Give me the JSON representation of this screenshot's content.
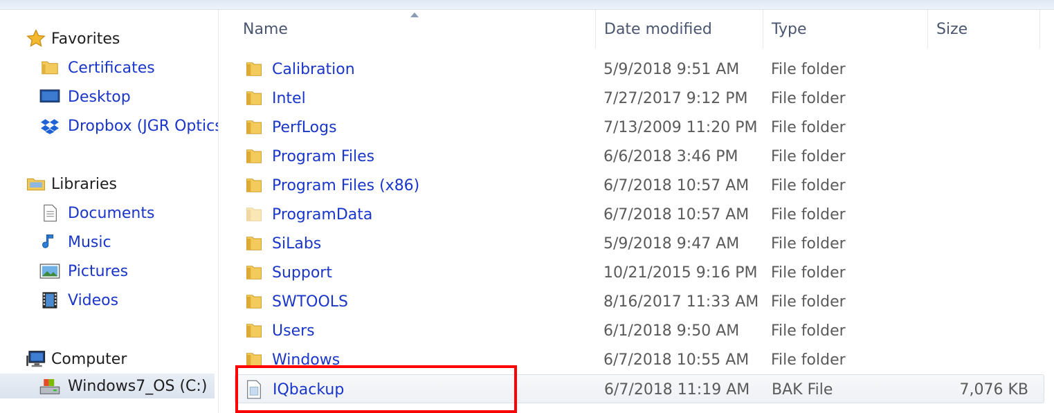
{
  "nav": {
    "favorites": {
      "label": "Favorites",
      "items": [
        {
          "label": "Certificates",
          "icon": "folder-icon"
        },
        {
          "label": "Desktop",
          "icon": "desktop-icon"
        },
        {
          "label": "Dropbox (JGR Optics",
          "icon": "dropbox-icon"
        }
      ]
    },
    "libraries": {
      "label": "Libraries",
      "items": [
        {
          "label": "Documents",
          "icon": "document-icon"
        },
        {
          "label": "Music",
          "icon": "music-note-icon"
        },
        {
          "label": "Pictures",
          "icon": "picture-icon"
        },
        {
          "label": "Videos",
          "icon": "film-icon"
        }
      ]
    },
    "computer": {
      "label": "Computer",
      "items": [
        {
          "label": "Windows7_OS (C:)",
          "icon": "drive-icon",
          "selected": true
        }
      ]
    }
  },
  "columns": {
    "name": "Name",
    "date": "Date modified",
    "type": "Type",
    "size": "Size"
  },
  "files": [
    {
      "name": "Calibration",
      "date": "5/9/2018 9:51 AM",
      "type": "File folder",
      "size": ""
    },
    {
      "name": "Intel",
      "date": "7/27/2017 9:12 PM",
      "type": "File folder",
      "size": ""
    },
    {
      "name": "PerfLogs",
      "date": "7/13/2009 11:20 PM",
      "type": "File folder",
      "size": ""
    },
    {
      "name": "Program Files",
      "date": "6/6/2018 3:46 PM",
      "type": "File folder",
      "size": ""
    },
    {
      "name": "Program Files (x86)",
      "date": "6/7/2018 10:57 AM",
      "type": "File folder",
      "size": ""
    },
    {
      "name": "ProgramData",
      "date": "6/7/2018 10:57 AM",
      "type": "File folder",
      "size": "",
      "hidden": true
    },
    {
      "name": "SiLabs",
      "date": "5/9/2018 9:47 AM",
      "type": "File folder",
      "size": ""
    },
    {
      "name": "Support",
      "date": "10/21/2015 9:16 PM",
      "type": "File folder",
      "size": ""
    },
    {
      "name": "SWTOOLS",
      "date": "8/16/2017 11:33 AM",
      "type": "File folder",
      "size": ""
    },
    {
      "name": "Users",
      "date": "6/1/2018 9:50 AM",
      "type": "File folder",
      "size": ""
    },
    {
      "name": "Windows",
      "date": "6/7/2018 10:55 AM",
      "type": "File folder",
      "size": ""
    },
    {
      "name": "IQbackup",
      "date": "6/7/2018 11:19 AM",
      "type": "BAK File",
      "size": "7,076 KB",
      "selected": true
    }
  ],
  "colors": {
    "link": "#1a36c8",
    "highlight": "#ff0000",
    "folder": "#e8b93a"
  }
}
